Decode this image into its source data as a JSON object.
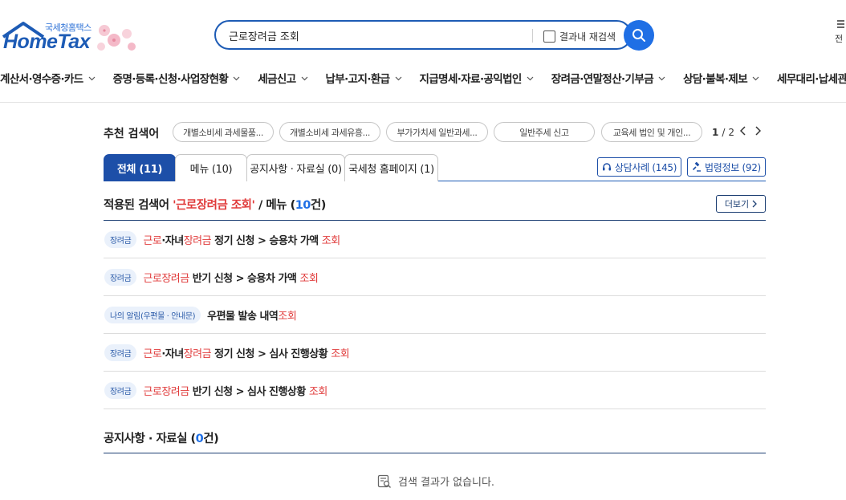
{
  "logo": {
    "sub": "국세청홈택스",
    "main": "HomeTax"
  },
  "search": {
    "value": "근로장려금 조회",
    "research_label": "결과내 재검색"
  },
  "all_menu_label": "전",
  "gnb": [
    "계산서·영수증·카드",
    "증명·등록·신청·사업장현황",
    "세금신고",
    "납부·고지·환급",
    "지급명세·자료·공익법인",
    "장려금·연말정산·기부금",
    "상담·불복·제보",
    "세무대리·납세관"
  ],
  "recommend": {
    "label": "추천 검색어",
    "chips": [
      "개별소비세 과세물품...",
      "개별소비세 과세유흥...",
      "부가가치세 일반과세...",
      "일반주세 신고",
      "교육세 법인 및 개인..."
    ],
    "page_current": "1",
    "page_sep": "/",
    "page_total": "2"
  },
  "tabs": [
    "전체 (11)",
    "메뉴 (10)",
    "공지사항 · 자료실 (0)",
    "국세청 홈페이지 (1)"
  ],
  "side_buttons": {
    "consult": "상담사례 (145)",
    "law": "법령정보 (92)"
  },
  "menu_section": {
    "prefix": "적용된 검색어 ",
    "term": "'근로장려금 조회'",
    "mid": " / 메뉴 (",
    "count": "10",
    "suffix": "건)",
    "more": "더보기"
  },
  "results": [
    {
      "badge": "장려금",
      "parts": [
        [
          "근로",
          true
        ],
        [
          "·자녀",
          false
        ],
        [
          "장려금",
          true
        ],
        [
          " 정기 신청 > 승용차 가액 ",
          false
        ],
        [
          "조회",
          true
        ]
      ]
    },
    {
      "badge": "장려금",
      "parts": [
        [
          "근로장려금",
          true
        ],
        [
          " 반기 신청 > 승용차 가액 ",
          false
        ],
        [
          "조회",
          true
        ]
      ]
    },
    {
      "badge": "나의 알림(우편물 · 안내문)",
      "parts": [
        [
          "우편물 발송 내역",
          false
        ],
        [
          "조회",
          true
        ]
      ]
    },
    {
      "badge": "장려금",
      "parts": [
        [
          "근로",
          true
        ],
        [
          "·자녀",
          false
        ],
        [
          "장려금",
          true
        ],
        [
          " 정기 신청 > 심사 진행상황 ",
          false
        ],
        [
          "조회",
          true
        ]
      ]
    },
    {
      "badge": "장려금",
      "parts": [
        [
          "근로장려금",
          true
        ],
        [
          " 반기 신청 > 심사 진행상황 ",
          false
        ],
        [
          "조회",
          true
        ]
      ]
    }
  ],
  "notice_section": {
    "prefix": "공지사항 · 자료실 (",
    "count": "0",
    "suffix": "건)"
  },
  "empty_text": "검색 결과가 없습니다.",
  "colors": {
    "brand_blue": "#1d4fa8",
    "accent_blue": "#1f6fe5",
    "highlight_red": "#e03a3a"
  }
}
